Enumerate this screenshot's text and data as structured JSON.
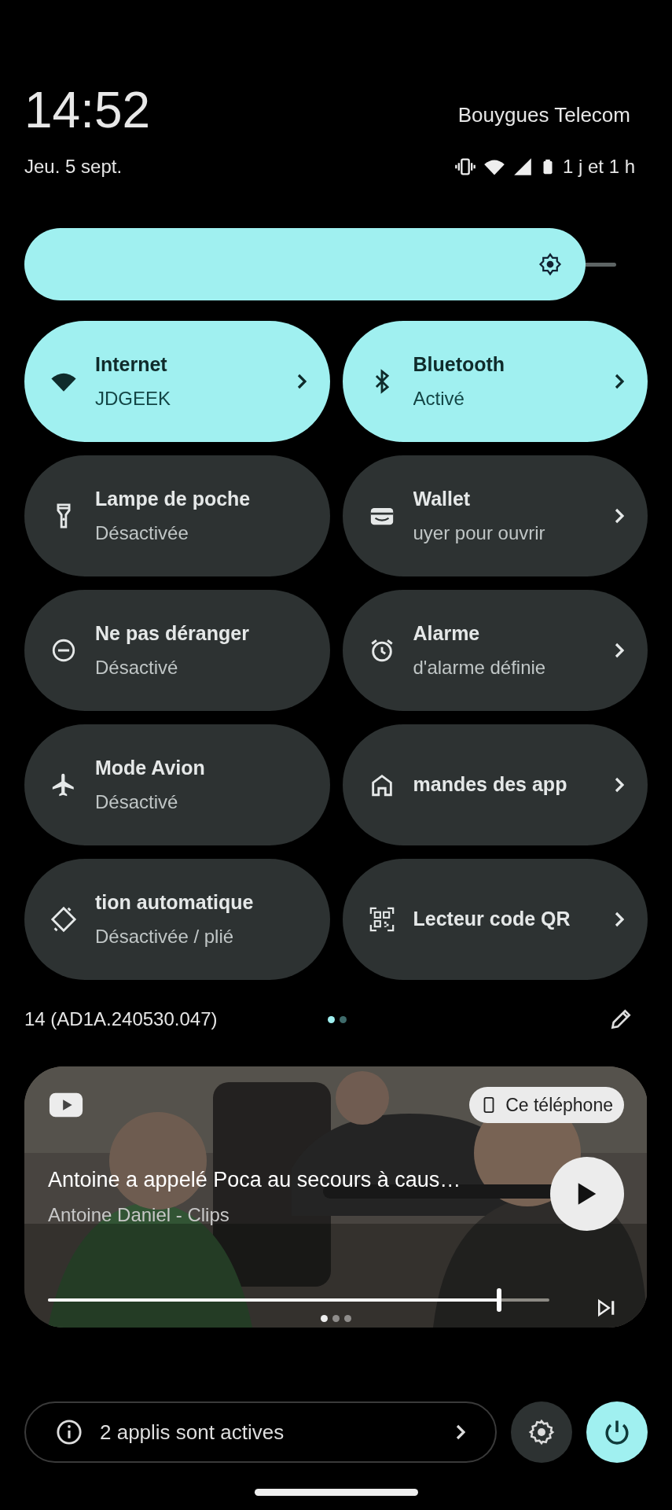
{
  "header": {
    "time": "14:52",
    "date": "Jeu. 5 sept.",
    "carrier": "Bouygues Telecom",
    "battery_text": "1 j et 1 h"
  },
  "brightness": {
    "level": 0.9
  },
  "tiles": [
    {
      "title": "Internet",
      "subtitle": "JDGEEK",
      "active": true,
      "chevron": true
    },
    {
      "title": "Bluetooth",
      "subtitle": "Activé",
      "active": true,
      "chevron": true
    },
    {
      "title": "Lampe de poche",
      "subtitle": "Désactivée",
      "active": false,
      "chevron": false
    },
    {
      "title": "Wallet",
      "subtitle": "uyer pour ouvrir",
      "active": false,
      "chevron": true
    },
    {
      "title": "Ne pas déranger",
      "subtitle": "Désactivé",
      "active": false,
      "chevron": false
    },
    {
      "title": "Alarme",
      "subtitle": "d'alarme définie",
      "active": false,
      "chevron": true
    },
    {
      "title": "Mode Avion",
      "subtitle": "Désactivé",
      "active": false,
      "chevron": false
    },
    {
      "title": "mandes des app",
      "active": false,
      "chevron": true
    },
    {
      "title": "tion automatique",
      "subtitle": "Désactivée / plié",
      "active": false,
      "chevron": false
    },
    {
      "title": "Lecteur code QR",
      "active": false,
      "chevron": true
    }
  ],
  "footer": {
    "build": "14 (AD1A.240530.047)",
    "pages": [
      {
        "selected": true
      },
      {
        "selected": false
      }
    ]
  },
  "media": {
    "kind": "picture",
    "output": "Ce téléphone",
    "title": "Antoine a appelé Poca au secours à caus…",
    "artist": "Antoine Daniel - Clips",
    "level": 0.9,
    "pages": [
      {
        "selected": true
      },
      {
        "selected": false
      },
      {
        "selected": false
      }
    ]
  },
  "bottom": {
    "active_apps": "2 applis sont actives",
    "power_active": true
  }
}
